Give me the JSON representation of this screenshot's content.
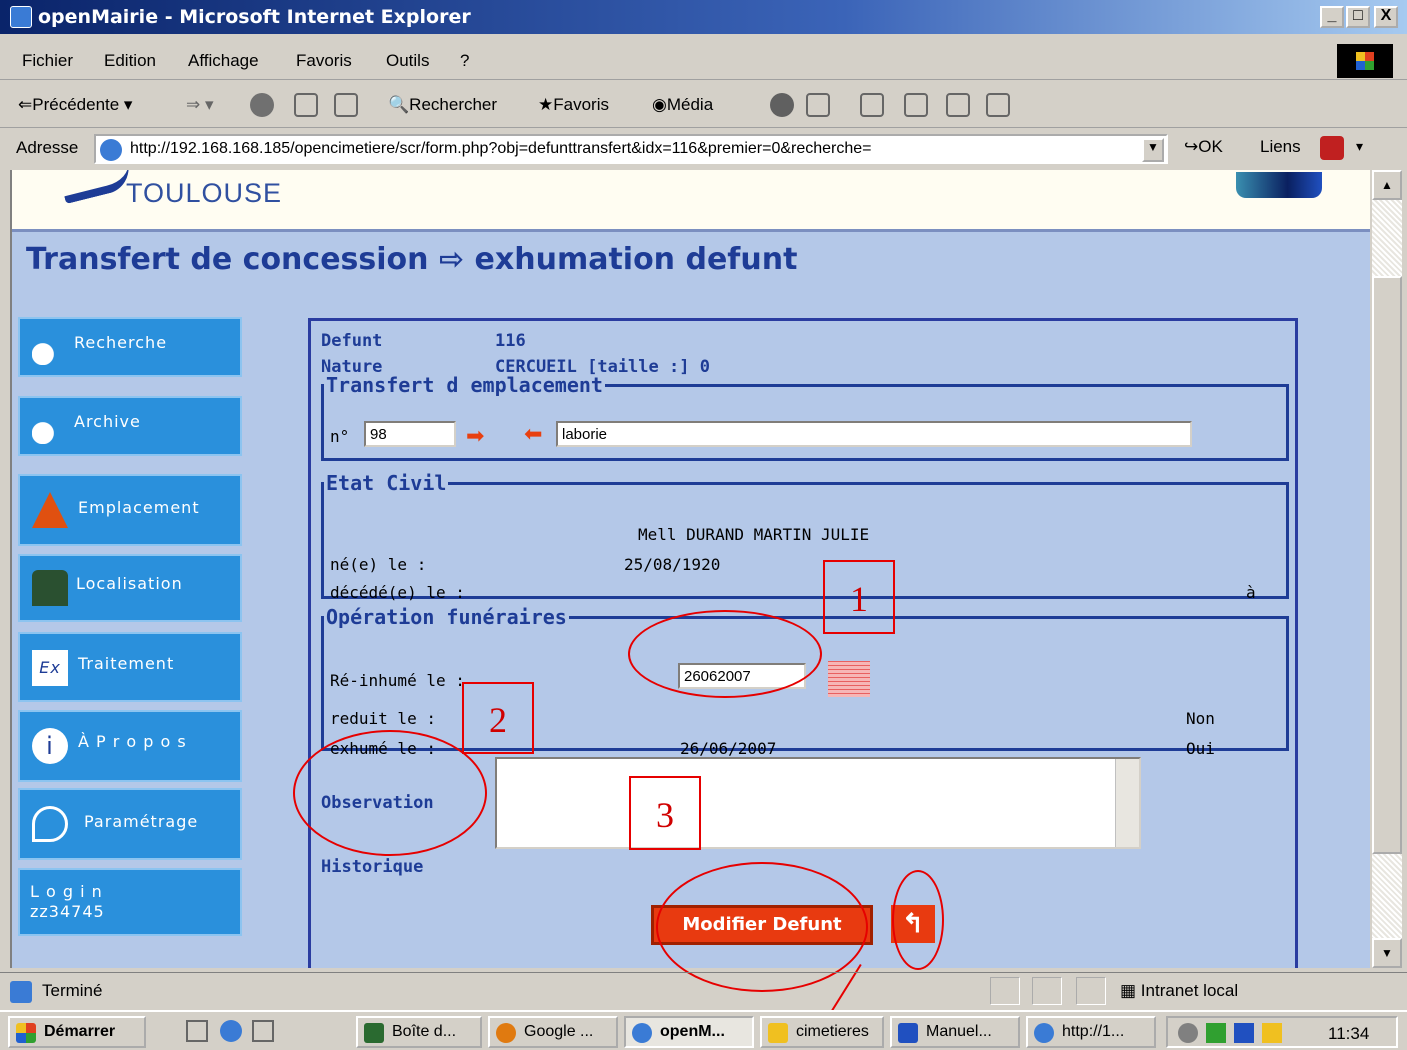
{
  "window": {
    "title": "openMairie - Microsoft Internet Explorer",
    "min": "_",
    "max": "□",
    "close": "X"
  },
  "menu": [
    "Fichier",
    "Edition",
    "Affichage",
    "Favoris",
    "Outils",
    "?"
  ],
  "toolbar": {
    "back": "Précédente",
    "search": "Rechercher",
    "favorites": "Favoris",
    "media": "Média"
  },
  "address": {
    "label": "Adresse",
    "url": "http://192.168.168.185/opencimetiere/scr/form.php?obj=defunttransfert&idx=116&premier=0&recherche=",
    "go": "OK",
    "links": "Liens"
  },
  "header": {
    "logo_text": "TOULOUSE"
  },
  "page": {
    "title": "Transfert de concession ⇨ exhumation defunt"
  },
  "nav": [
    {
      "label": "Recherche"
    },
    {
      "label": "Archive"
    },
    {
      "label": "Emplacement"
    },
    {
      "label": "Localisation"
    },
    {
      "label": "Traitement"
    },
    {
      "label": "À P r o p o s"
    },
    {
      "label": "Paramétrage"
    },
    {
      "label": "L o g i n\nzz34745"
    }
  ],
  "form": {
    "defunt_label": "Defunt",
    "defunt_value": "116",
    "nature_label": "Nature",
    "nature_value": "CERCUEIL [taille :] 0",
    "transfert_legend": "Transfert d emplacement",
    "num_label": "n°",
    "num_value": "98",
    "emplacement_value": "laborie",
    "etat_legend": "Etat Civil",
    "civil_name": "Mell DURAND MARTIN JULIE",
    "ne_label": "né(e) le :",
    "ne_value": "25/08/1920",
    "decede_label": "décédé(e) le :",
    "decede_at": "à",
    "operation_legend": "Opération funéraires",
    "reinhume_label": "Ré-inhumé le :",
    "reinhume_value": "26062007",
    "reduit_label": "reduit le :",
    "reduit_value": "Non",
    "exhume_label": "exhumé le :",
    "exhume_date": "26/06/2007",
    "exhume_value": "Oui",
    "observation_label": "Observation",
    "historique_label": "Historique",
    "submit_label": "Modifier Defunt",
    "return_icon": "↰"
  },
  "annotations": [
    "1",
    "2",
    "3"
  ],
  "status": {
    "text": "Terminé",
    "zone": "Intranet local"
  },
  "taskbar": {
    "start": "Démarrer",
    "tasks": [
      "Boîte d...",
      "Google ...",
      "openM...",
      "cimetieres",
      "Manuel...",
      "http://1..."
    ],
    "clock": "11:34"
  },
  "colors": {
    "accent": "#1e3c96",
    "nav": "#2a90dc",
    "page_bg": "#b4c8e8",
    "submit": "#e83a10",
    "annotation": "#e60000"
  }
}
